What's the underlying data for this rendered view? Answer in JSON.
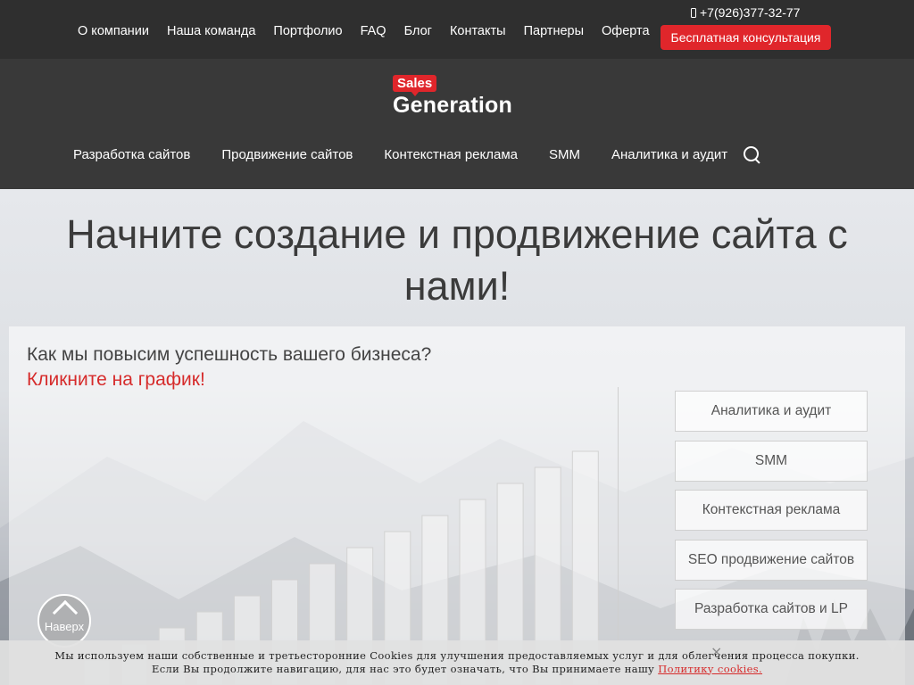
{
  "topbar": {
    "nav": [
      "О компании",
      "Наша команда",
      "Портфолио",
      "FAQ",
      "Блог",
      "Контакты",
      "Партнеры",
      "Оферта"
    ],
    "phone": "+7(926)377-32-77",
    "cta_label": "Бесплатная консультация"
  },
  "logo": {
    "badge": "Sales",
    "word": "Generation"
  },
  "mainnav": [
    "Разработка сайтов",
    "Продвижение сайтов",
    "Контекстная реклама",
    "SMM",
    "Аналитика и аудит"
  ],
  "hero": {
    "title": "Начните создание и продвижение сайта с нами!",
    "question": "Как мы повысим успешность вашего бизнеса?",
    "click_prompt": "Кликните на график!"
  },
  "chart_data": {
    "type": "bar",
    "values": [
      1,
      2,
      3,
      4,
      5,
      6,
      7,
      8,
      9,
      10,
      11,
      12,
      13,
      14
    ]
  },
  "services": [
    "Аналитика и аудит",
    "SMM",
    "Контекстная реклама",
    "SEO продвижение сайтов",
    "Разработка сайтов и LP"
  ],
  "totop_label": "Наверх",
  "cookies": {
    "line1": "Мы используем наши собственные и третьесторонние Cookies для улучшения предоставляемых услуг и для облегчения процесса покупки.",
    "line2": "Если Вы продолжите навигацию, для нас это будет означать, что Вы принимаете нашу",
    "link": "Политику cookies."
  },
  "colors": {
    "accent": "#e0262b",
    "dark": "#2f2f2f",
    "header": "#393939"
  }
}
